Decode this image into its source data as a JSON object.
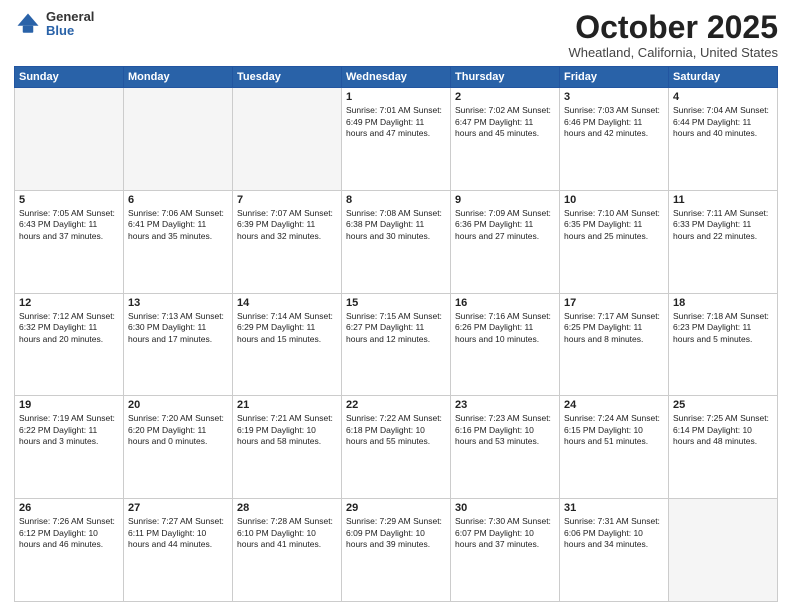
{
  "logo": {
    "general": "General",
    "blue": "Blue"
  },
  "header": {
    "month": "October 2025",
    "location": "Wheatland, California, United States"
  },
  "days_of_week": [
    "Sunday",
    "Monday",
    "Tuesday",
    "Wednesday",
    "Thursday",
    "Friday",
    "Saturday"
  ],
  "weeks": [
    [
      {
        "day": "",
        "text": ""
      },
      {
        "day": "",
        "text": ""
      },
      {
        "day": "",
        "text": ""
      },
      {
        "day": "1",
        "text": "Sunrise: 7:01 AM\nSunset: 6:49 PM\nDaylight: 11 hours\nand 47 minutes."
      },
      {
        "day": "2",
        "text": "Sunrise: 7:02 AM\nSunset: 6:47 PM\nDaylight: 11 hours\nand 45 minutes."
      },
      {
        "day": "3",
        "text": "Sunrise: 7:03 AM\nSunset: 6:46 PM\nDaylight: 11 hours\nand 42 minutes."
      },
      {
        "day": "4",
        "text": "Sunrise: 7:04 AM\nSunset: 6:44 PM\nDaylight: 11 hours\nand 40 minutes."
      }
    ],
    [
      {
        "day": "5",
        "text": "Sunrise: 7:05 AM\nSunset: 6:43 PM\nDaylight: 11 hours\nand 37 minutes."
      },
      {
        "day": "6",
        "text": "Sunrise: 7:06 AM\nSunset: 6:41 PM\nDaylight: 11 hours\nand 35 minutes."
      },
      {
        "day": "7",
        "text": "Sunrise: 7:07 AM\nSunset: 6:39 PM\nDaylight: 11 hours\nand 32 minutes."
      },
      {
        "day": "8",
        "text": "Sunrise: 7:08 AM\nSunset: 6:38 PM\nDaylight: 11 hours\nand 30 minutes."
      },
      {
        "day": "9",
        "text": "Sunrise: 7:09 AM\nSunset: 6:36 PM\nDaylight: 11 hours\nand 27 minutes."
      },
      {
        "day": "10",
        "text": "Sunrise: 7:10 AM\nSunset: 6:35 PM\nDaylight: 11 hours\nand 25 minutes."
      },
      {
        "day": "11",
        "text": "Sunrise: 7:11 AM\nSunset: 6:33 PM\nDaylight: 11 hours\nand 22 minutes."
      }
    ],
    [
      {
        "day": "12",
        "text": "Sunrise: 7:12 AM\nSunset: 6:32 PM\nDaylight: 11 hours\nand 20 minutes."
      },
      {
        "day": "13",
        "text": "Sunrise: 7:13 AM\nSunset: 6:30 PM\nDaylight: 11 hours\nand 17 minutes."
      },
      {
        "day": "14",
        "text": "Sunrise: 7:14 AM\nSunset: 6:29 PM\nDaylight: 11 hours\nand 15 minutes."
      },
      {
        "day": "15",
        "text": "Sunrise: 7:15 AM\nSunset: 6:27 PM\nDaylight: 11 hours\nand 12 minutes."
      },
      {
        "day": "16",
        "text": "Sunrise: 7:16 AM\nSunset: 6:26 PM\nDaylight: 11 hours\nand 10 minutes."
      },
      {
        "day": "17",
        "text": "Sunrise: 7:17 AM\nSunset: 6:25 PM\nDaylight: 11 hours\nand 8 minutes."
      },
      {
        "day": "18",
        "text": "Sunrise: 7:18 AM\nSunset: 6:23 PM\nDaylight: 11 hours\nand 5 minutes."
      }
    ],
    [
      {
        "day": "19",
        "text": "Sunrise: 7:19 AM\nSunset: 6:22 PM\nDaylight: 11 hours\nand 3 minutes."
      },
      {
        "day": "20",
        "text": "Sunrise: 7:20 AM\nSunset: 6:20 PM\nDaylight: 11 hours\nand 0 minutes."
      },
      {
        "day": "21",
        "text": "Sunrise: 7:21 AM\nSunset: 6:19 PM\nDaylight: 10 hours\nand 58 minutes."
      },
      {
        "day": "22",
        "text": "Sunrise: 7:22 AM\nSunset: 6:18 PM\nDaylight: 10 hours\nand 55 minutes."
      },
      {
        "day": "23",
        "text": "Sunrise: 7:23 AM\nSunset: 6:16 PM\nDaylight: 10 hours\nand 53 minutes."
      },
      {
        "day": "24",
        "text": "Sunrise: 7:24 AM\nSunset: 6:15 PM\nDaylight: 10 hours\nand 51 minutes."
      },
      {
        "day": "25",
        "text": "Sunrise: 7:25 AM\nSunset: 6:14 PM\nDaylight: 10 hours\nand 48 minutes."
      }
    ],
    [
      {
        "day": "26",
        "text": "Sunrise: 7:26 AM\nSunset: 6:12 PM\nDaylight: 10 hours\nand 46 minutes."
      },
      {
        "day": "27",
        "text": "Sunrise: 7:27 AM\nSunset: 6:11 PM\nDaylight: 10 hours\nand 44 minutes."
      },
      {
        "day": "28",
        "text": "Sunrise: 7:28 AM\nSunset: 6:10 PM\nDaylight: 10 hours\nand 41 minutes."
      },
      {
        "day": "29",
        "text": "Sunrise: 7:29 AM\nSunset: 6:09 PM\nDaylight: 10 hours\nand 39 minutes."
      },
      {
        "day": "30",
        "text": "Sunrise: 7:30 AM\nSunset: 6:07 PM\nDaylight: 10 hours\nand 37 minutes."
      },
      {
        "day": "31",
        "text": "Sunrise: 7:31 AM\nSunset: 6:06 PM\nDaylight: 10 hours\nand 34 minutes."
      },
      {
        "day": "",
        "text": ""
      }
    ]
  ]
}
